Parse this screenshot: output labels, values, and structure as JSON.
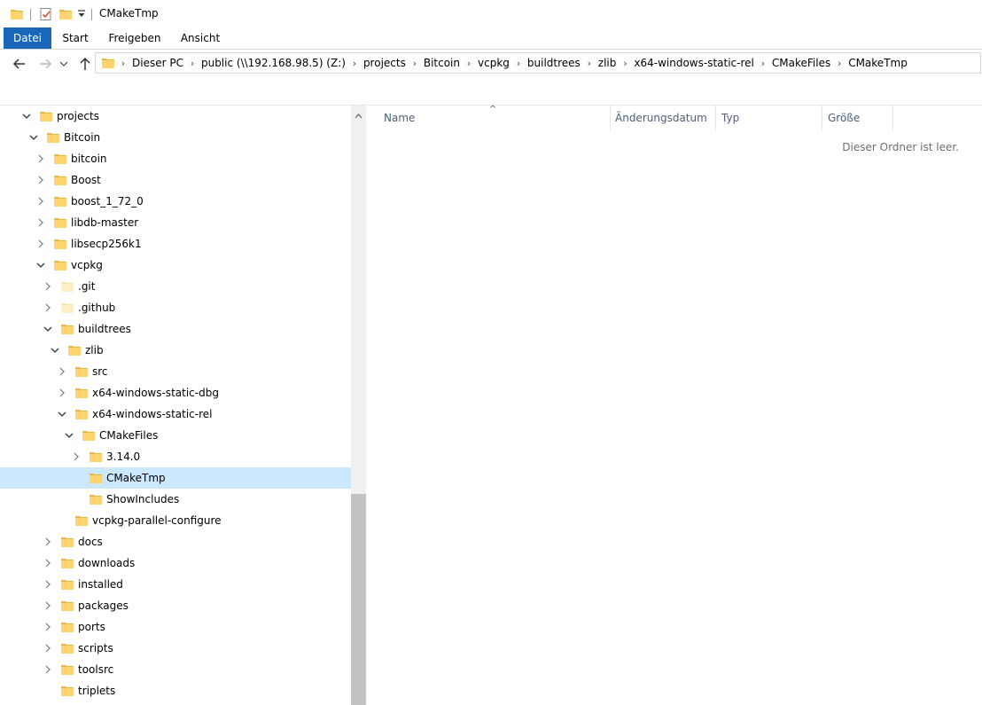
{
  "window": {
    "title": "CMakeTmp"
  },
  "ribbon": {
    "tabs": [
      "Datei",
      "Start",
      "Freigeben",
      "Ansicht"
    ]
  },
  "address": {
    "crumbs": [
      "Dieser PC",
      "public (\\\\192.168.98.5) (Z:)",
      "projects",
      "Bitcoin",
      "vcpkg",
      "buildtrees",
      "zlib",
      "x64-windows-static-rel",
      "CMakeFiles",
      "CMakeTmp"
    ]
  },
  "tree": [
    {
      "label": "projects",
      "depth": 0,
      "toggle": "open",
      "selected": false,
      "faded": false
    },
    {
      "label": "Bitcoin",
      "depth": 1,
      "toggle": "open",
      "selected": false,
      "faded": false
    },
    {
      "label": "bitcoin",
      "depth": 2,
      "toggle": "closed",
      "selected": false,
      "faded": false
    },
    {
      "label": "Boost",
      "depth": 2,
      "toggle": "closed",
      "selected": false,
      "faded": false
    },
    {
      "label": "boost_1_72_0",
      "depth": 2,
      "toggle": "closed",
      "selected": false,
      "faded": false
    },
    {
      "label": "libdb-master",
      "depth": 2,
      "toggle": "closed",
      "selected": false,
      "faded": false
    },
    {
      "label": "libsecp256k1",
      "depth": 2,
      "toggle": "closed",
      "selected": false,
      "faded": false
    },
    {
      "label": "vcpkg",
      "depth": 2,
      "toggle": "open",
      "selected": false,
      "faded": false
    },
    {
      "label": ".git",
      "depth": 3,
      "toggle": "closed",
      "selected": false,
      "faded": true
    },
    {
      "label": ".github",
      "depth": 3,
      "toggle": "closed",
      "selected": false,
      "faded": true
    },
    {
      "label": "buildtrees",
      "depth": 3,
      "toggle": "open",
      "selected": false,
      "faded": false
    },
    {
      "label": "zlib",
      "depth": 4,
      "toggle": "open",
      "selected": false,
      "faded": false
    },
    {
      "label": "src",
      "depth": 5,
      "toggle": "closed",
      "selected": false,
      "faded": false
    },
    {
      "label": "x64-windows-static-dbg",
      "depth": 5,
      "toggle": "closed",
      "selected": false,
      "faded": false
    },
    {
      "label": "x64-windows-static-rel",
      "depth": 5,
      "toggle": "open",
      "selected": false,
      "faded": false
    },
    {
      "label": "CMakeFiles",
      "depth": 6,
      "toggle": "open",
      "selected": false,
      "faded": false
    },
    {
      "label": "3.14.0",
      "depth": 7,
      "toggle": "closed",
      "selected": false,
      "faded": false
    },
    {
      "label": "CMakeTmp",
      "depth": 7,
      "toggle": "none",
      "selected": true,
      "faded": false
    },
    {
      "label": "ShowIncludes",
      "depth": 7,
      "toggle": "none",
      "selected": false,
      "faded": false
    },
    {
      "label": "vcpkg-parallel-configure",
      "depth": 5,
      "toggle": "none",
      "selected": false,
      "faded": false
    },
    {
      "label": "docs",
      "depth": 3,
      "toggle": "closed",
      "selected": false,
      "faded": false
    },
    {
      "label": "downloads",
      "depth": 3,
      "toggle": "closed",
      "selected": false,
      "faded": false
    },
    {
      "label": "installed",
      "depth": 3,
      "toggle": "closed",
      "selected": false,
      "faded": false
    },
    {
      "label": "packages",
      "depth": 3,
      "toggle": "closed",
      "selected": false,
      "faded": false
    },
    {
      "label": "ports",
      "depth": 3,
      "toggle": "closed",
      "selected": false,
      "faded": false
    },
    {
      "label": "scripts",
      "depth": 3,
      "toggle": "closed",
      "selected": false,
      "faded": false
    },
    {
      "label": "toolsrc",
      "depth": 3,
      "toggle": "closed",
      "selected": false,
      "faded": false
    },
    {
      "label": "triplets",
      "depth": 3,
      "toggle": "none",
      "selected": false,
      "faded": false
    }
  ],
  "columns": {
    "name": "Name",
    "date": "Änderungsdatum",
    "type": "Typ",
    "size": "Größe"
  },
  "content": {
    "empty_message": "Dieser Ordner ist leer."
  },
  "icons": {
    "folder": "folder-icon",
    "properties": "properties-icon",
    "new_folder": "new-folder-icon",
    "customize": "customize-toolbar-icon",
    "back": "back-arrow-icon",
    "forward": "forward-arrow-icon",
    "recent": "recent-locations-icon",
    "up": "up-arrow-icon"
  },
  "colors": {
    "accent": "#1a66b8",
    "selection": "#cce8ff",
    "folder": "#ffd36e"
  }
}
